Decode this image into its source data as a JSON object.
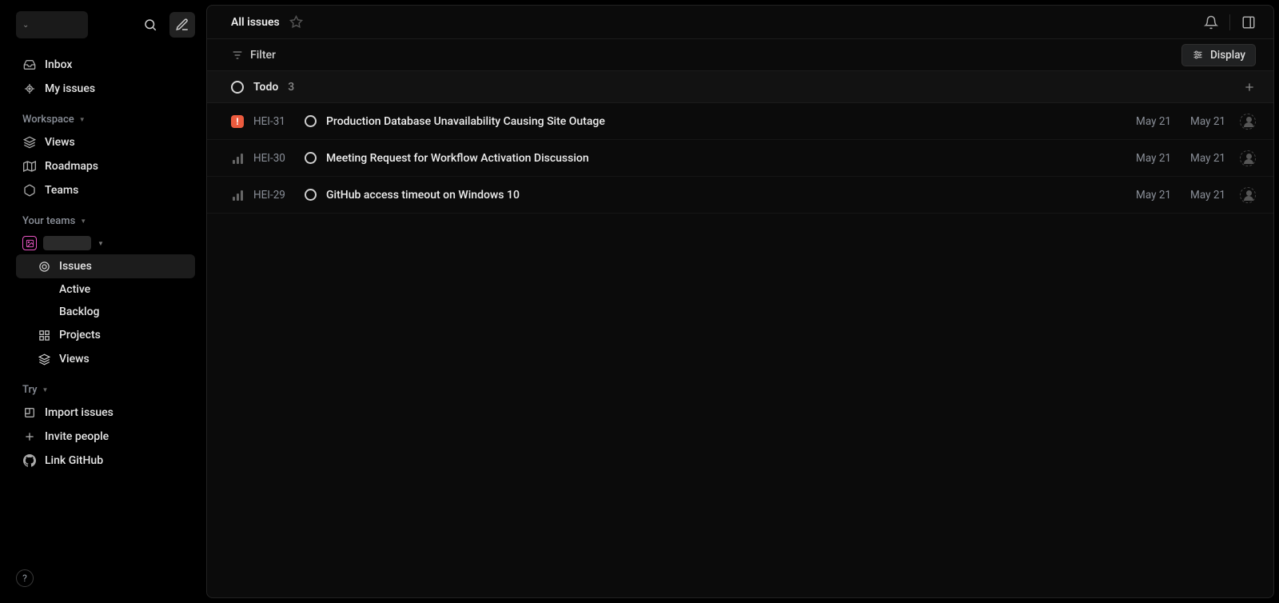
{
  "sidebar": {
    "inbox": "Inbox",
    "my_issues": "My issues",
    "workspace_header": "Workspace",
    "views": "Views",
    "roadmaps": "Roadmaps",
    "teams": "Teams",
    "your_teams_header": "Your teams",
    "team_issues": "Issues",
    "team_active": "Active",
    "team_backlog": "Backlog",
    "team_projects": "Projects",
    "team_views": "Views",
    "try_header": "Try",
    "import_issues": "Import issues",
    "invite_people": "Invite people",
    "link_github": "Link GitHub",
    "help": "?"
  },
  "header": {
    "title": "All issues"
  },
  "filterbar": {
    "filter": "Filter",
    "display": "Display"
  },
  "group": {
    "status": "Todo",
    "count": "3"
  },
  "issues": [
    {
      "priority": "urgent",
      "id": "HEI-31",
      "title": "Production Database Unavailability Causing Site Outage",
      "created": "May 21",
      "updated": "May 21"
    },
    {
      "priority": "none",
      "id": "HEI-30",
      "title": "Meeting Request for Workflow Activation Discussion",
      "created": "May 21",
      "updated": "May 21"
    },
    {
      "priority": "none",
      "id": "HEI-29",
      "title": "GitHub access timeout on Windows 10",
      "created": "May 21",
      "updated": "May 21"
    }
  ]
}
